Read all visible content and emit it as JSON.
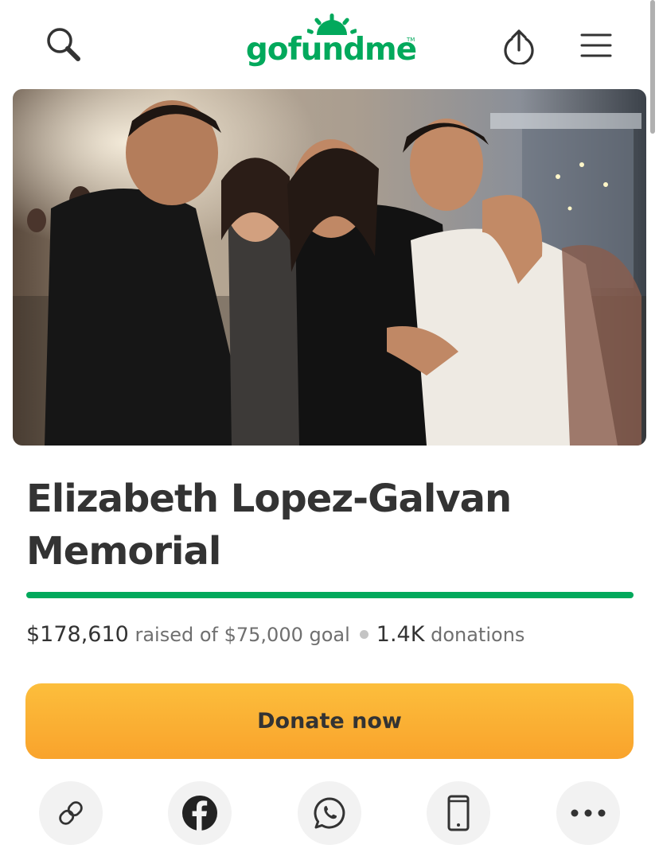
{
  "header": {
    "logo_text": "gofundme",
    "logo_tm": "TM",
    "icons": {
      "search": "search-icon",
      "share": "share-upload-icon",
      "menu": "hamburger-menu-icon"
    }
  },
  "campaign": {
    "title": "Elizabeth Lopez-Galvan Memorial",
    "raised": "$178,610",
    "raised_label": "raised of $75,000 goal",
    "donations_count": "1.4K",
    "donations_label": "donations",
    "progress_fraction": 1.0
  },
  "actions": {
    "donate_label": "Donate now"
  },
  "share_buttons": [
    {
      "name": "copy-link",
      "icon": "link-icon"
    },
    {
      "name": "facebook",
      "icon": "facebook-icon"
    },
    {
      "name": "whatsapp",
      "icon": "whatsapp-icon"
    },
    {
      "name": "device",
      "icon": "phone-icon"
    },
    {
      "name": "more",
      "icon": "more-dots-icon"
    }
  ],
  "colors": {
    "brand": "#02a95c",
    "donate_button": "#fbb034",
    "text": "#333333",
    "muted_text": "#6f6f6f"
  }
}
